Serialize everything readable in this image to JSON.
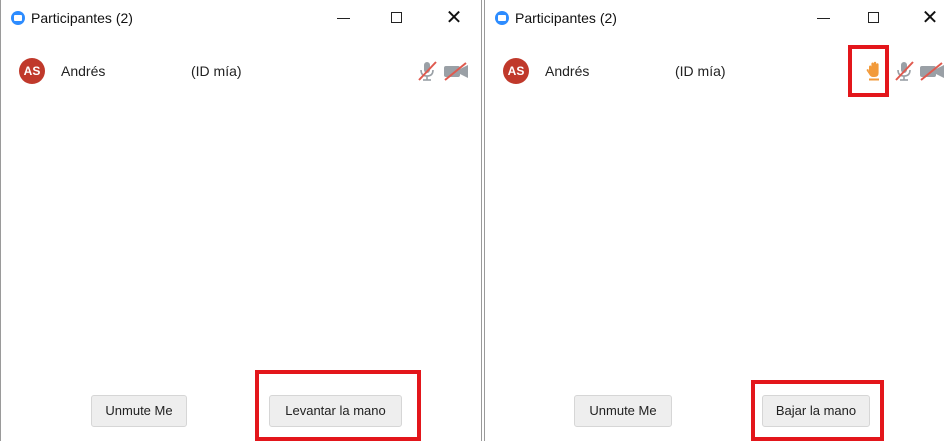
{
  "left_window": {
    "title": "Participantes (2)",
    "controls": {
      "minimize": "—",
      "maximize": "☐",
      "close": "✕"
    },
    "participant": {
      "initials": "AS",
      "name": "Andrés",
      "id_label": "(ID mía)"
    },
    "buttons": {
      "unmute": "Unmute Me",
      "hand": "Levantar la mano"
    }
  },
  "right_window": {
    "title": "Participantes (2)",
    "controls": {
      "minimize": "—",
      "maximize": "☐",
      "close": "✕"
    },
    "participant": {
      "initials": "AS",
      "name": "Andrés",
      "id_label": "(ID mía)"
    },
    "buttons": {
      "unmute": "Unmute Me",
      "hand": "Bajar la mano"
    }
  },
  "colors": {
    "accent": "#2d8cff",
    "avatar": "#c0392b",
    "muted_icon": "#e05a4f",
    "hand_icon": "#f29a3a",
    "highlight": "#e3161b"
  },
  "icons": [
    "zoom-icon",
    "microphone-muted-icon",
    "video-off-icon",
    "raised-hand-icon"
  ]
}
